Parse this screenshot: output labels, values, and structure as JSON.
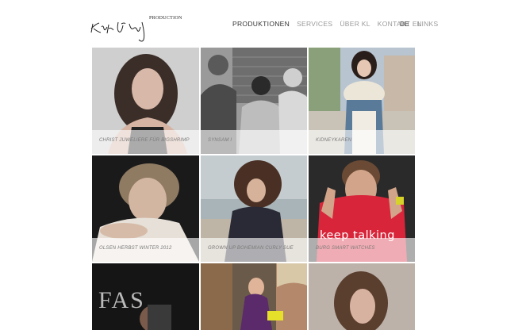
{
  "logo": {
    "production_label": "PRODUCTION"
  },
  "nav": {
    "items": [
      {
        "label": "PRODUKTIONEN",
        "active": true
      },
      {
        "label": "SERVICES",
        "active": false
      },
      {
        "label": "ÜBER KL",
        "active": false
      },
      {
        "label": "KONTAKT",
        "active": false
      },
      {
        "label": "LINKS",
        "active": false
      }
    ]
  },
  "lang": {
    "de": "DE",
    "en": "EN"
  },
  "tiles": [
    {
      "caption": "CHRIST JUWELIERE FÜR BIGSHRIMP"
    },
    {
      "caption": "SYNSAM I"
    },
    {
      "caption": "KIDNEYKAREN"
    },
    {
      "caption": "OLSEN HERBST WINTER 2012"
    },
    {
      "caption": "GROWN UP BOHEMIAN CURLY SUE"
    },
    {
      "caption": "BURG SMART WATCHES",
      "overlay_text": "keep talking"
    },
    {
      "caption": "",
      "overlay_text": "FAS"
    },
    {
      "caption": ""
    },
    {
      "caption": ""
    }
  ]
}
